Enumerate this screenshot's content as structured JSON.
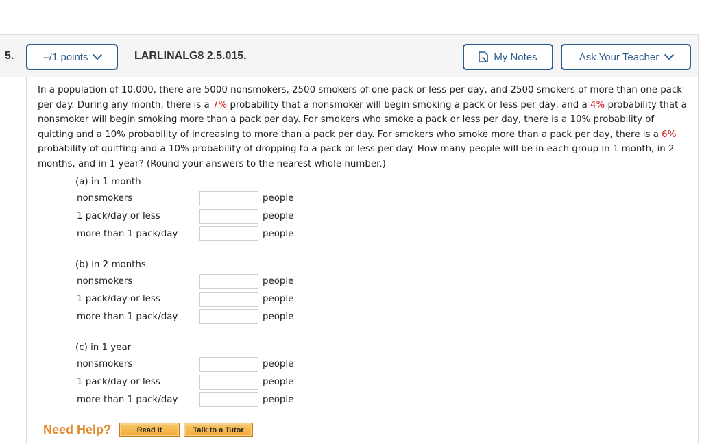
{
  "question": {
    "number": "5.",
    "points_label": "–/1 points",
    "id": "LARLINALG8 2.5.015.",
    "my_notes_label": "My Notes",
    "ask_teacher_label": "Ask Your Teacher"
  },
  "prompt": {
    "p1": "In a population of 10,000, there are 5000 nonsmokers, 2500 smokers of one pack or less per day, and 2500 smokers of more than one pack per day. During any month, there is a ",
    "r1": "7%",
    "p2": " probability that a nonsmoker will begin smoking a pack or less per day, and a ",
    "r2": "4%",
    "p3": " probability that a nonsmoker will begin smoking more than a pack per day. For smokers who smoke a pack or less per day, there is a 10% probability of quitting and a 10% probability of increasing to more than a pack per day. For smokers who smoke more than a pack per day, there is a ",
    "r3": "6%",
    "p4": " probability of quitting and a 10% probability of dropping to a pack or less per day. How many people will be in each group in 1 month, in 2 months, and in 1 year? (Round your answers to the nearest whole number.)"
  },
  "parts": [
    {
      "title": "(a) in 1 month",
      "rows": [
        {
          "label": "nonsmokers",
          "value": "",
          "unit": "people"
        },
        {
          "label": "1 pack/day or less",
          "value": "",
          "unit": "people"
        },
        {
          "label": "more than 1 pack/day",
          "value": "",
          "unit": "people"
        }
      ]
    },
    {
      "title": "(b) in 2 months",
      "rows": [
        {
          "label": "nonsmokers",
          "value": "",
          "unit": "people"
        },
        {
          "label": "1 pack/day or less",
          "value": "",
          "unit": "people"
        },
        {
          "label": "more than 1 pack/day",
          "value": "",
          "unit": "people"
        }
      ]
    },
    {
      "title": "(c) in 1 year",
      "rows": [
        {
          "label": "nonsmokers",
          "value": "",
          "unit": "people"
        },
        {
          "label": "1 pack/day or less",
          "value": "",
          "unit": "people"
        },
        {
          "label": "more than 1 pack/day",
          "value": "",
          "unit": "people"
        }
      ]
    }
  ],
  "help": {
    "label": "Need Help?",
    "read_it": "Read It",
    "tutor": "Talk to a Tutor"
  },
  "colors": {
    "accent": "#2c5c8c",
    "highlight_red": "#cc2222",
    "help_orange": "#e08a2c"
  }
}
